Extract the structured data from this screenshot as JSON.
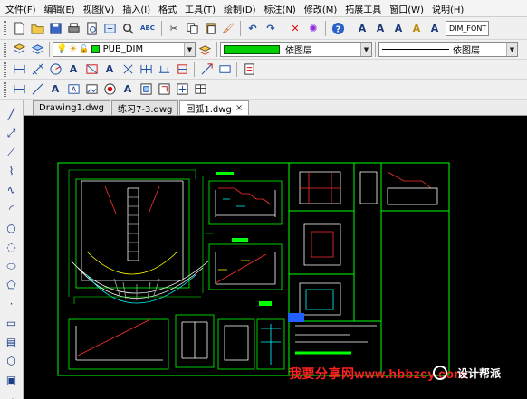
{
  "menubar": {
    "items": [
      {
        "label": "文件(F)"
      },
      {
        "label": "编辑(E)"
      },
      {
        "label": "视图(V)"
      },
      {
        "label": "插入(I)"
      },
      {
        "label": "格式"
      },
      {
        "label": "工具(T)"
      },
      {
        "label": "绘制(D)"
      },
      {
        "label": "标注(N)"
      },
      {
        "label": "修改(M)"
      },
      {
        "label": "拓展工具"
      },
      {
        "label": "窗口(W)"
      },
      {
        "label": "说明(H)"
      }
    ]
  },
  "toolbar1": {
    "spell_check_label": "ABC",
    "dim_font_style": "DIM_FONT"
  },
  "toolbar2": {
    "layer_combo": {
      "value": "PUB_DIM",
      "swatch_color": "#00e000"
    },
    "color_combo": {
      "value": "依图层",
      "color": "#00d000"
    },
    "linetype_combo": {
      "value": "依图层"
    }
  },
  "tabs": [
    {
      "label": "Drawing1.dwg",
      "active": false
    },
    {
      "label": "练习7-3.dwg",
      "active": false
    },
    {
      "label": "回弧1.dwg",
      "active": true
    }
  ],
  "tab_close_glyph": "×",
  "drawing": {
    "background": "#000000",
    "frame_color": "#00ff00",
    "line_color": "#ffffff",
    "accent_colors": [
      "#ff3030",
      "#ffff00",
      "#00ffff",
      "#2060ff"
    ]
  },
  "watermark": {
    "text": "我要分享网www.hbbzcy.com",
    "brand": "设计帮派",
    "color": "#ff2020"
  }
}
